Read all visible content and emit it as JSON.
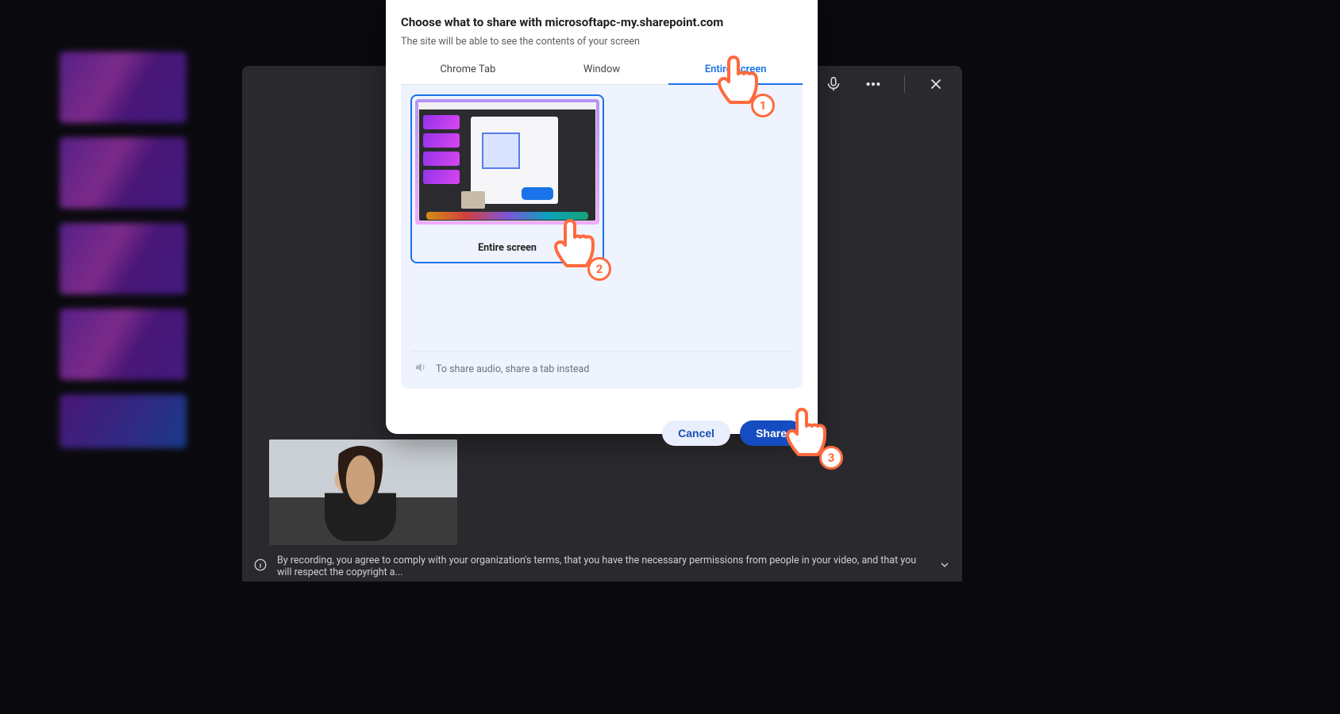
{
  "dialog": {
    "title": "Choose what to share with microsoftapc-my.sharepoint.com",
    "subtitle": "The site will be able to see the contents of your screen",
    "tabs": {
      "chrome": "Chrome Tab",
      "window": "Window",
      "entire": "Entire Screen"
    },
    "screen_option_label": "Entire screen",
    "audio_note": "To share audio, share a tab instead",
    "cancel": "Cancel",
    "share": "Share"
  },
  "info_bar": {
    "text": "By recording, you agree to comply with your organization's terms, that you have the necessary permissions from people in your video, and that you will respect the copyright a..."
  },
  "annotations": {
    "p1": "1",
    "p2": "2",
    "p3": "3"
  }
}
